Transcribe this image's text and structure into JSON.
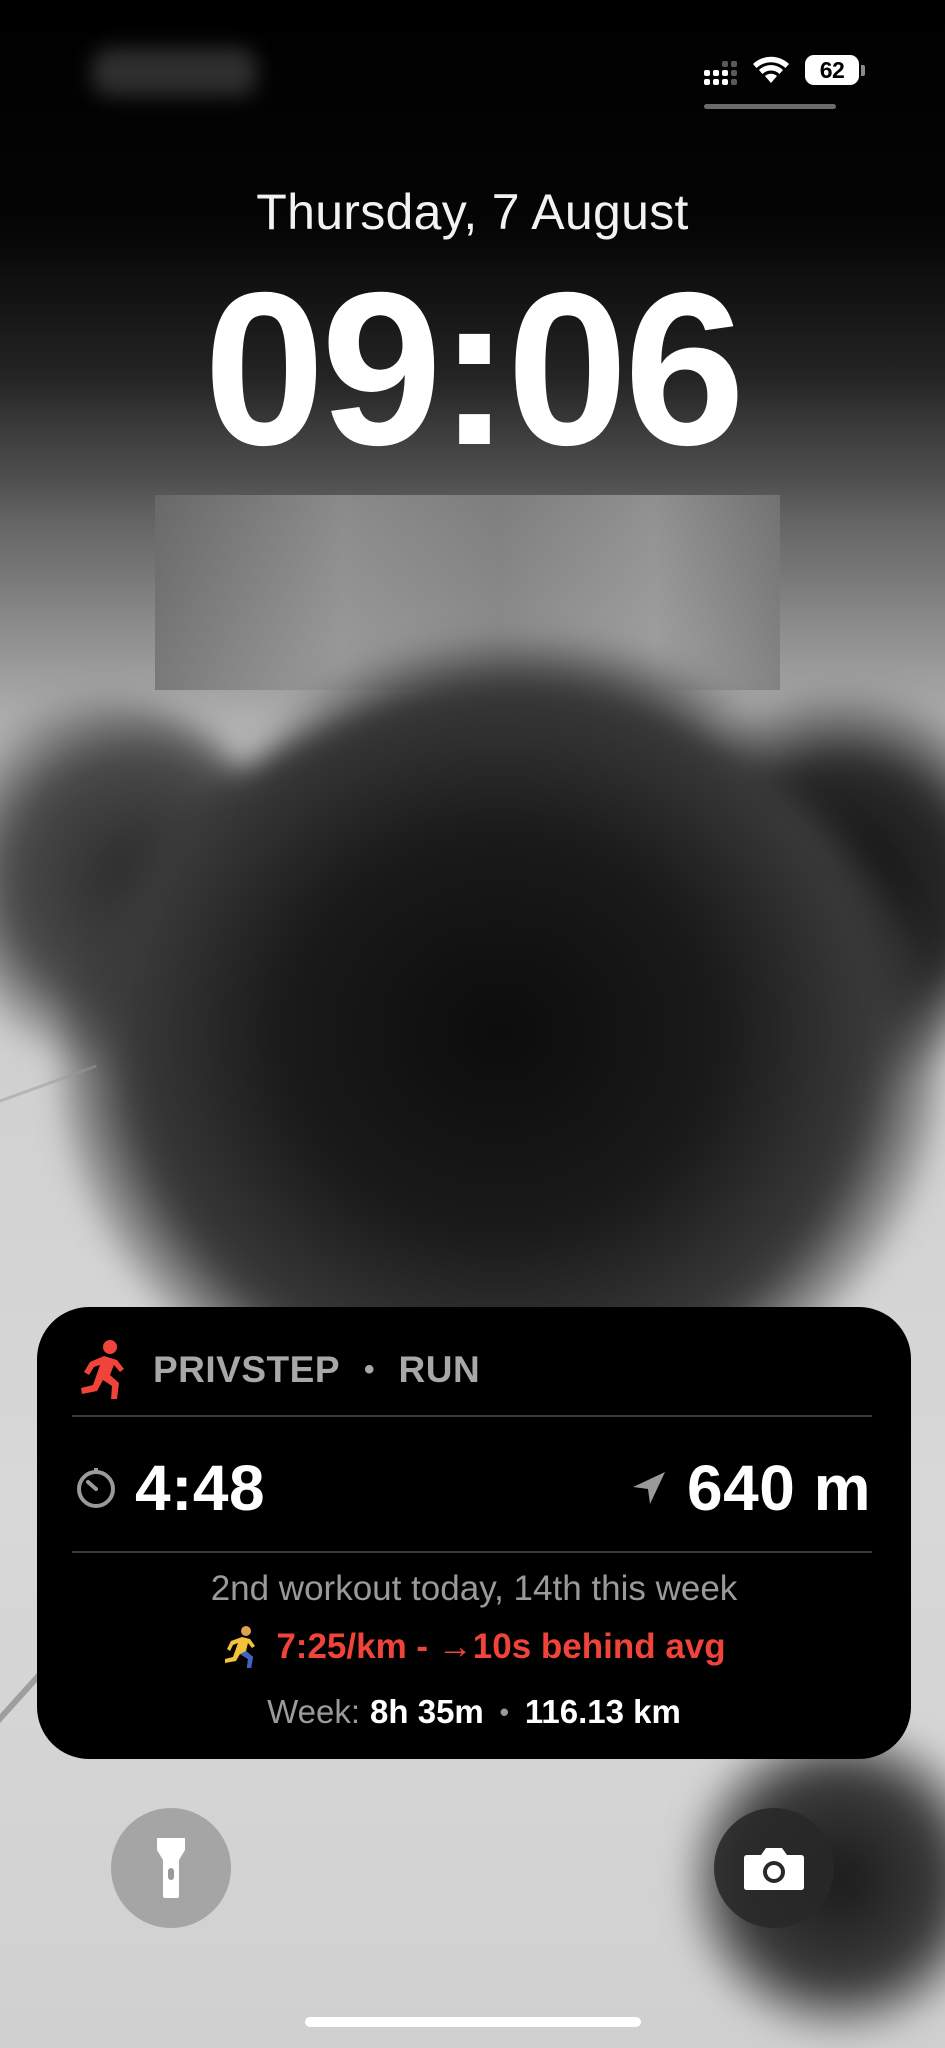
{
  "status_bar": {
    "battery_level": "62",
    "signal_icon": "cellular-signal-icon",
    "wifi_icon": "wifi-icon",
    "battery_icon": "battery-icon"
  },
  "lock_screen": {
    "date": "Thursday, 7 August",
    "time": "09:06"
  },
  "live_activity": {
    "app_name": "PRIVSTEP",
    "separator": "•",
    "activity_type": "RUN",
    "elapsed_time": "4:48",
    "distance": "640 m",
    "workout_summary": "2nd workout today, 14th this week",
    "pace_text": "7:25/km - →10s behind avg",
    "week_label": "Week:",
    "week_time": "8h 35m",
    "week_separator": "•",
    "week_distance": "116.13 km",
    "accent_color": "#f0443a"
  },
  "quick_actions": {
    "flashlight_icon": "flashlight-icon",
    "camera_icon": "camera-icon"
  }
}
